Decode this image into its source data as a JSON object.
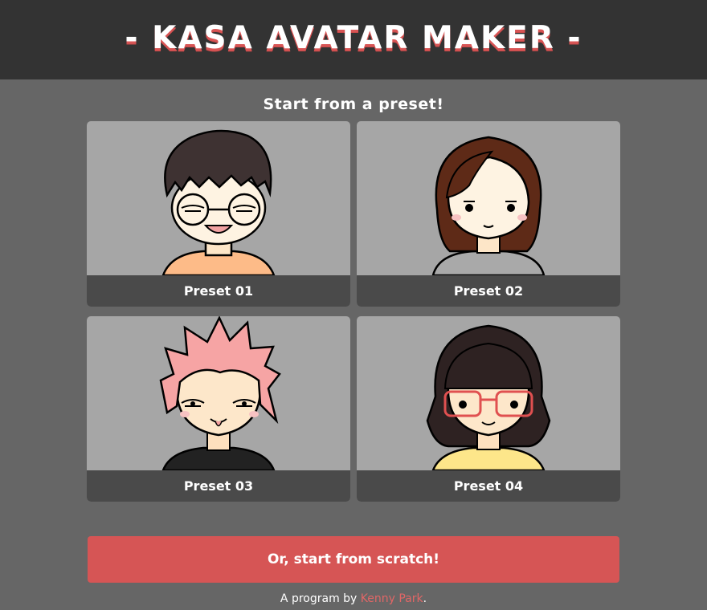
{
  "header": {
    "title": "- KASA AVATAR MAKER -"
  },
  "presets_section": {
    "heading": "Start from a preset!",
    "items": [
      {
        "label": "Preset 01",
        "avatar": "boy-glasses-avatar"
      },
      {
        "label": "Preset 02",
        "avatar": "girl-brown-hair-avatar"
      },
      {
        "label": "Preset 03",
        "avatar": "pink-spiky-hair-avatar"
      },
      {
        "label": "Preset 04",
        "avatar": "girl-red-glasses-avatar"
      }
    ]
  },
  "scratch_button": {
    "label": "Or, start from scratch!"
  },
  "footer": {
    "prefix": "A program by ",
    "author": "Kenny Park",
    "suffix": "."
  },
  "colors": {
    "page_bg": "#666666",
    "header_bg": "#333333",
    "card_bg": "#a6a6a6",
    "label_bar": "#4a4a4a",
    "accent": "#d65555",
    "author_link": "#e06666"
  }
}
